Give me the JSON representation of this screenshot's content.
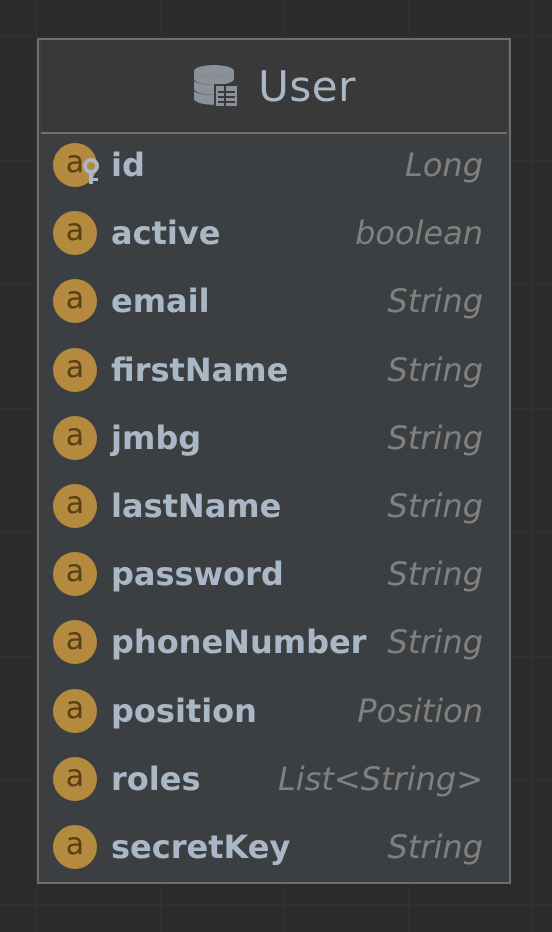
{
  "entity": {
    "title": "User",
    "icon": "database-table-icon",
    "fields": [
      {
        "name": "id",
        "type": "Long",
        "badge": "a",
        "primary_key": true
      },
      {
        "name": "active",
        "type": "boolean",
        "badge": "a",
        "primary_key": false
      },
      {
        "name": "email",
        "type": "String",
        "badge": "a",
        "primary_key": false
      },
      {
        "name": "firstName",
        "type": "String",
        "badge": "a",
        "primary_key": false
      },
      {
        "name": "jmbg",
        "type": "String",
        "badge": "a",
        "primary_key": false
      },
      {
        "name": "lastName",
        "type": "String",
        "badge": "a",
        "primary_key": false
      },
      {
        "name": "password",
        "type": "String",
        "badge": "a",
        "primary_key": false
      },
      {
        "name": "phoneNumber",
        "type": "String",
        "badge": "a",
        "primary_key": false
      },
      {
        "name": "position",
        "type": "Position",
        "badge": "a",
        "primary_key": false
      },
      {
        "name": "roles",
        "type": "List<String>",
        "badge": "a",
        "primary_key": false
      },
      {
        "name": "secretKey",
        "type": "String",
        "badge": "a",
        "primary_key": false
      }
    ]
  },
  "colors": {
    "canvas_background": "#2b2b2b",
    "entity_background": "#3c3f41",
    "header_background": "#393939",
    "border": "#6e6e6e",
    "field_name": "#a9b7c6",
    "field_type": "#808080",
    "badge_fill": "#b38a3e",
    "badge_text": "#5a3f12",
    "key_icon": "#a9b7c6"
  }
}
